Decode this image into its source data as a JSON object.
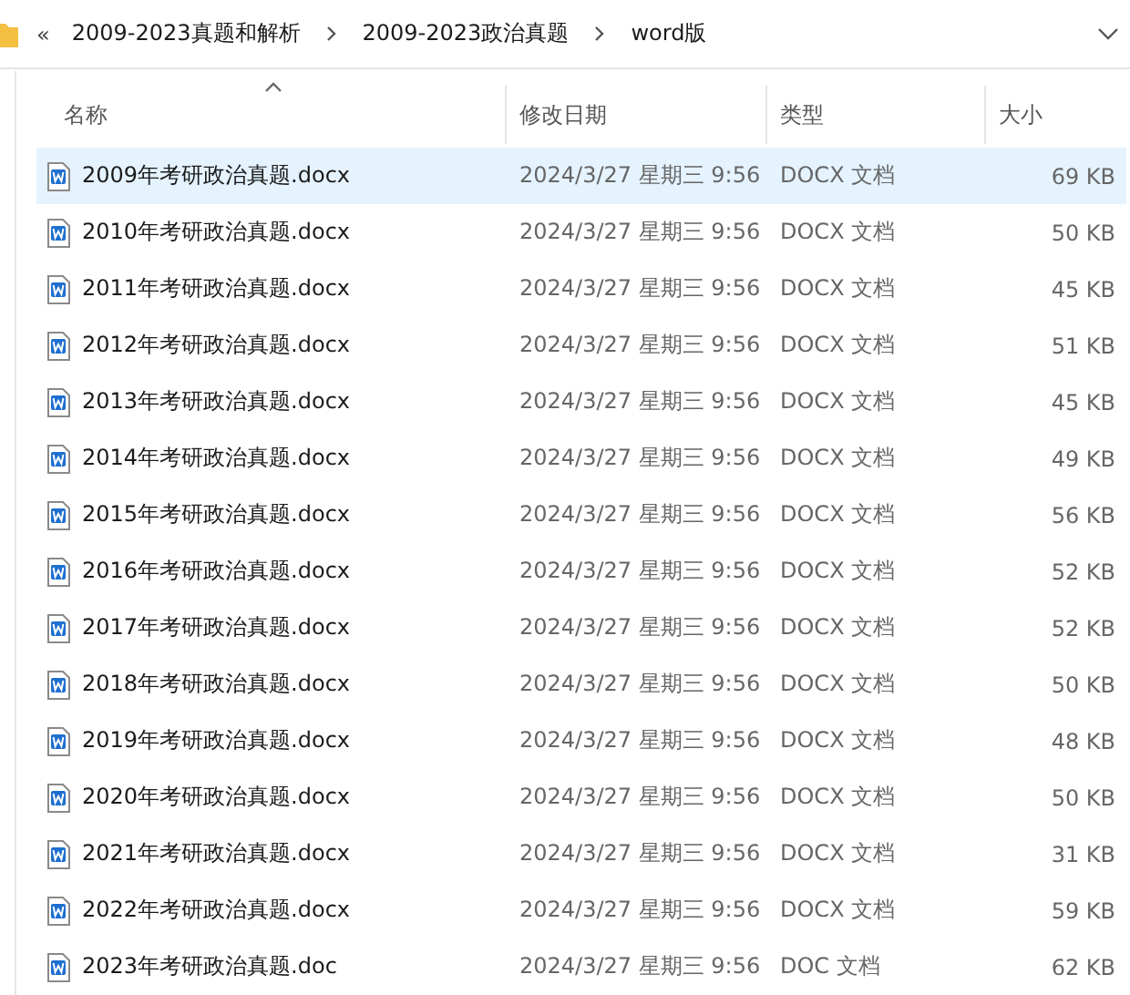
{
  "breadcrumb": {
    "overflow": "«",
    "items": [
      "2009-2023真题和解析",
      "2009-2023政治真题",
      "word版"
    ]
  },
  "table": {
    "columns": [
      {
        "label": "名称",
        "sorted": true
      },
      {
        "label": "修改日期",
        "sorted": false
      },
      {
        "label": "类型",
        "sorted": false
      },
      {
        "label": "大小",
        "sorted": false
      }
    ],
    "rows": [
      {
        "name": "2009年考研政治真题.docx",
        "date": "2024/3/27 星期三 9:56",
        "type": "DOCX 文档",
        "size": "69 KB",
        "selected": true
      },
      {
        "name": "2010年考研政治真题.docx",
        "date": "2024/3/27 星期三 9:56",
        "type": "DOCX 文档",
        "size": "50 KB",
        "selected": false
      },
      {
        "name": "2011年考研政治真题.docx",
        "date": "2024/3/27 星期三 9:56",
        "type": "DOCX 文档",
        "size": "45 KB",
        "selected": false
      },
      {
        "name": "2012年考研政治真题.docx",
        "date": "2024/3/27 星期三 9:56",
        "type": "DOCX 文档",
        "size": "51 KB",
        "selected": false
      },
      {
        "name": "2013年考研政治真题.docx",
        "date": "2024/3/27 星期三 9:56",
        "type": "DOCX 文档",
        "size": "45 KB",
        "selected": false
      },
      {
        "name": "2014年考研政治真题.docx",
        "date": "2024/3/27 星期三 9:56",
        "type": "DOCX 文档",
        "size": "49 KB",
        "selected": false
      },
      {
        "name": "2015年考研政治真题.docx",
        "date": "2024/3/27 星期三 9:56",
        "type": "DOCX 文档",
        "size": "56 KB",
        "selected": false
      },
      {
        "name": "2016年考研政治真题.docx",
        "date": "2024/3/27 星期三 9:56",
        "type": "DOCX 文档",
        "size": "52 KB",
        "selected": false
      },
      {
        "name": "2017年考研政治真题.docx",
        "date": "2024/3/27 星期三 9:56",
        "type": "DOCX 文档",
        "size": "52 KB",
        "selected": false
      },
      {
        "name": "2018年考研政治真题.docx",
        "date": "2024/3/27 星期三 9:56",
        "type": "DOCX 文档",
        "size": "50 KB",
        "selected": false
      },
      {
        "name": "2019年考研政治真题.docx",
        "date": "2024/3/27 星期三 9:56",
        "type": "DOCX 文档",
        "size": "48 KB",
        "selected": false
      },
      {
        "name": "2020年考研政治真题.docx",
        "date": "2024/3/27 星期三 9:56",
        "type": "DOCX 文档",
        "size": "50 KB",
        "selected": false
      },
      {
        "name": "2021年考研政治真题.docx",
        "date": "2024/3/27 星期三 9:56",
        "type": "DOCX 文档",
        "size": "31 KB",
        "selected": false
      },
      {
        "name": "2022年考研政治真题.docx",
        "date": "2024/3/27 星期三 9:56",
        "type": "DOCX 文档",
        "size": "59 KB",
        "selected": false
      },
      {
        "name": "2023年考研政治真题.doc",
        "date": "2024/3/27 星期三 9:56",
        "type": "DOC 文档",
        "size": "62 KB",
        "selected": false
      }
    ]
  }
}
